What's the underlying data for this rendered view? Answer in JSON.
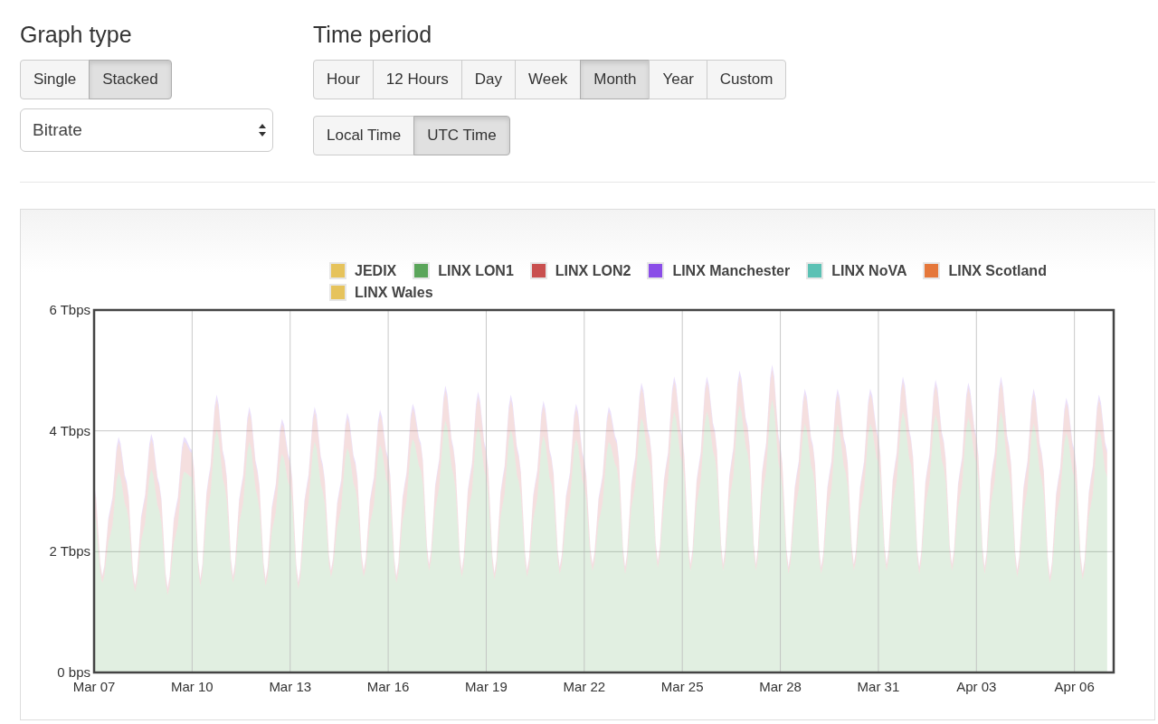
{
  "graph_type": {
    "heading": "Graph type",
    "options": [
      {
        "label": "Single",
        "selected": false
      },
      {
        "label": "Stacked",
        "selected": true
      }
    ],
    "metric_select": {
      "value": "Bitrate"
    }
  },
  "time_period": {
    "heading": "Time period",
    "ranges": [
      {
        "label": "Hour",
        "selected": false
      },
      {
        "label": "12 Hours",
        "selected": false
      },
      {
        "label": "Day",
        "selected": false
      },
      {
        "label": "Week",
        "selected": false
      },
      {
        "label": "Month",
        "selected": true
      },
      {
        "label": "Year",
        "selected": false
      },
      {
        "label": "Custom",
        "selected": false
      }
    ],
    "zones": [
      {
        "label": "Local Time",
        "selected": false
      },
      {
        "label": "UTC Time",
        "selected": true
      }
    ]
  },
  "chart": {
    "legend": [
      {
        "kind": "idle",
        "label": "JEDIX",
        "color": "#e6c35c"
      },
      {
        "kind": "series"
      },
      {
        "kind": "series"
      },
      {
        "kind": "series"
      },
      {
        "kind": "idle",
        "label": "LINX NoVA",
        "color": "#5bc1b4"
      },
      {
        "kind": "idle",
        "label": "LINX Scotland",
        "color": "#e5773a"
      },
      {
        "kind": "idle",
        "label": "LINX Wales",
        "color": "#e6c35c"
      }
    ],
    "chart_data": {
      "type": "area",
      "stacked": true,
      "categories": [
        "Mar 07",
        null,
        null,
        null,
        null,
        null,
        null,
        null,
        null,
        null,
        null,
        null,
        "Mar 10",
        null,
        null,
        null,
        null,
        null,
        null,
        null,
        null,
        null,
        null,
        null,
        "Mar 13",
        null,
        null,
        null,
        null,
        null,
        null,
        null,
        null,
        null,
        null,
        null,
        "Mar 16",
        null,
        null,
        null,
        null,
        null,
        null,
        null,
        null,
        null,
        null,
        null,
        "Mar 19",
        null,
        null,
        null,
        null,
        null,
        null,
        null,
        null,
        null,
        null,
        null,
        "Mar 22",
        null,
        null,
        null,
        null,
        null,
        null,
        null,
        null,
        null,
        null,
        null,
        "Mar 25",
        null,
        null,
        null,
        null,
        null,
        null,
        null,
        null,
        null,
        null,
        null,
        "Mar 28",
        null,
        null,
        null,
        null,
        null,
        null,
        null,
        null,
        null,
        null,
        null,
        "Mar 31",
        null,
        null,
        null,
        null,
        null,
        null,
        null,
        null,
        null,
        null,
        null,
        "Apr 03",
        null,
        null,
        null,
        null,
        null,
        null,
        null,
        null,
        null,
        null,
        null,
        "Apr 06",
        null,
        null,
        null,
        null
      ],
      "series": [
        {
          "name": "LINX LON1",
          "color": "#5aa55a",
          "values": [
            2.67,
            1.48,
            2.28,
            3.32,
            2.71,
            1.33,
            2.32,
            3.37,
            2.67,
            1.28,
            2.28,
            3.32,
            3.23,
            1.43,
            2.77,
            4.02,
            3.07,
            1.48,
            2.63,
            3.82,
            2.91,
            1.43,
            2.49,
            3.62,
            3.07,
            1.38,
            2.63,
            3.82,
            2.99,
            1.58,
            2.56,
            3.72,
            3.03,
            1.58,
            2.6,
            3.77,
            3.11,
            1.48,
            2.67,
            3.87,
            3.35,
            1.68,
            2.88,
            4.17,
            3.27,
            1.58,
            2.81,
            4.07,
            3.23,
            1.53,
            2.77,
            4.02,
            3.15,
            1.58,
            2.7,
            3.92,
            3.11,
            1.63,
            2.67,
            3.87,
            3.07,
            1.68,
            2.63,
            3.82,
            3.39,
            1.63,
            2.91,
            4.22,
            3.47,
            1.73,
            2.98,
            4.32,
            3.47,
            1.68,
            2.98,
            4.32,
            3.55,
            1.68,
            3.05,
            4.42,
            3.63,
            1.68,
            3.12,
            4.52,
            3.31,
            1.63,
            2.84,
            4.12,
            3.31,
            1.63,
            2.84,
            4.12,
            3.31,
            1.68,
            2.84,
            4.12,
            3.47,
            1.68,
            2.98,
            4.32,
            3.43,
            1.63,
            2.95,
            4.27,
            3.39,
            1.68,
            2.91,
            4.22,
            3.47,
            1.63,
            2.98,
            4.32,
            3.31,
            1.58,
            2.84,
            4.12,
            3.19,
            1.48,
            2.74,
            3.97,
            3.23,
            1.53,
            2.77,
            4.02,
            3.23
          ]
        },
        {
          "name": "LINX LON2",
          "color": "#c9504f",
          "values": [
            0.4,
            0.1,
            0.4,
            0.5,
            0.4,
            0.1,
            0.4,
            0.5,
            0.4,
            0.1,
            0.4,
            0.5,
            0.4,
            0.1,
            0.4,
            0.5,
            0.4,
            0.1,
            0.4,
            0.5,
            0.4,
            0.1,
            0.4,
            0.5,
            0.4,
            0.1,
            0.4,
            0.5,
            0.4,
            0.1,
            0.4,
            0.5,
            0.4,
            0.1,
            0.4,
            0.5,
            0.4,
            0.1,
            0.4,
            0.5,
            0.4,
            0.1,
            0.4,
            0.5,
            0.4,
            0.1,
            0.4,
            0.5,
            0.4,
            0.1,
            0.4,
            0.5,
            0.4,
            0.1,
            0.4,
            0.5,
            0.4,
            0.1,
            0.4,
            0.5,
            0.4,
            0.1,
            0.4,
            0.5,
            0.4,
            0.1,
            0.4,
            0.5,
            0.4,
            0.1,
            0.4,
            0.5,
            0.4,
            0.1,
            0.4,
            0.5,
            0.4,
            0.1,
            0.4,
            0.5,
            0.4,
            0.1,
            0.4,
            0.5,
            0.4,
            0.1,
            0.4,
            0.5,
            0.4,
            0.1,
            0.4,
            0.5,
            0.4,
            0.1,
            0.4,
            0.5,
            0.4,
            0.1,
            0.4,
            0.5,
            0.4,
            0.1,
            0.4,
            0.5,
            0.4,
            0.1,
            0.4,
            0.5,
            0.4,
            0.1,
            0.4,
            0.5,
            0.4,
            0.1,
            0.4,
            0.5,
            0.4,
            0.1,
            0.4,
            0.5,
            0.4,
            0.1,
            0.4,
            0.5,
            0.4
          ]
        },
        {
          "name": "LINX Manchester",
          "color": "#8a4de8",
          "values": [
            0.05,
            0.02,
            0.05,
            0.08,
            0.05,
            0.02,
            0.05,
            0.08,
            0.05,
            0.02,
            0.05,
            0.08,
            0.05,
            0.02,
            0.05,
            0.08,
            0.05,
            0.02,
            0.05,
            0.08,
            0.05,
            0.02,
            0.05,
            0.08,
            0.05,
            0.02,
            0.05,
            0.08,
            0.05,
            0.02,
            0.05,
            0.08,
            0.05,
            0.02,
            0.05,
            0.08,
            0.05,
            0.02,
            0.05,
            0.08,
            0.05,
            0.02,
            0.05,
            0.08,
            0.05,
            0.02,
            0.05,
            0.08,
            0.05,
            0.02,
            0.05,
            0.08,
            0.05,
            0.02,
            0.05,
            0.08,
            0.05,
            0.02,
            0.05,
            0.08,
            0.05,
            0.02,
            0.05,
            0.08,
            0.05,
            0.02,
            0.05,
            0.08,
            0.05,
            0.02,
            0.05,
            0.08,
            0.05,
            0.02,
            0.05,
            0.08,
            0.05,
            0.02,
            0.05,
            0.08,
            0.05,
            0.02,
            0.05,
            0.08,
            0.05,
            0.02,
            0.05,
            0.08,
            0.05,
            0.02,
            0.05,
            0.08,
            0.05,
            0.02,
            0.05,
            0.08,
            0.05,
            0.02,
            0.05,
            0.08,
            0.05,
            0.02,
            0.05,
            0.08,
            0.05,
            0.02,
            0.05,
            0.08,
            0.05,
            0.02,
            0.05,
            0.08,
            0.05,
            0.02,
            0.05,
            0.08,
            0.05,
            0.02,
            0.05,
            0.08,
            0.05,
            0.02,
            0.05,
            0.08,
            0.05
          ]
        }
      ],
      "ylim": [
        0,
        6
      ],
      "yticks": [
        {
          "value": 0,
          "label": "0 bps"
        },
        {
          "value": 2,
          "label": "2 Tbps"
        },
        {
          "value": 4,
          "label": "4 Tbps"
        },
        {
          "value": 6,
          "label": "6 Tbps"
        }
      ]
    }
  }
}
